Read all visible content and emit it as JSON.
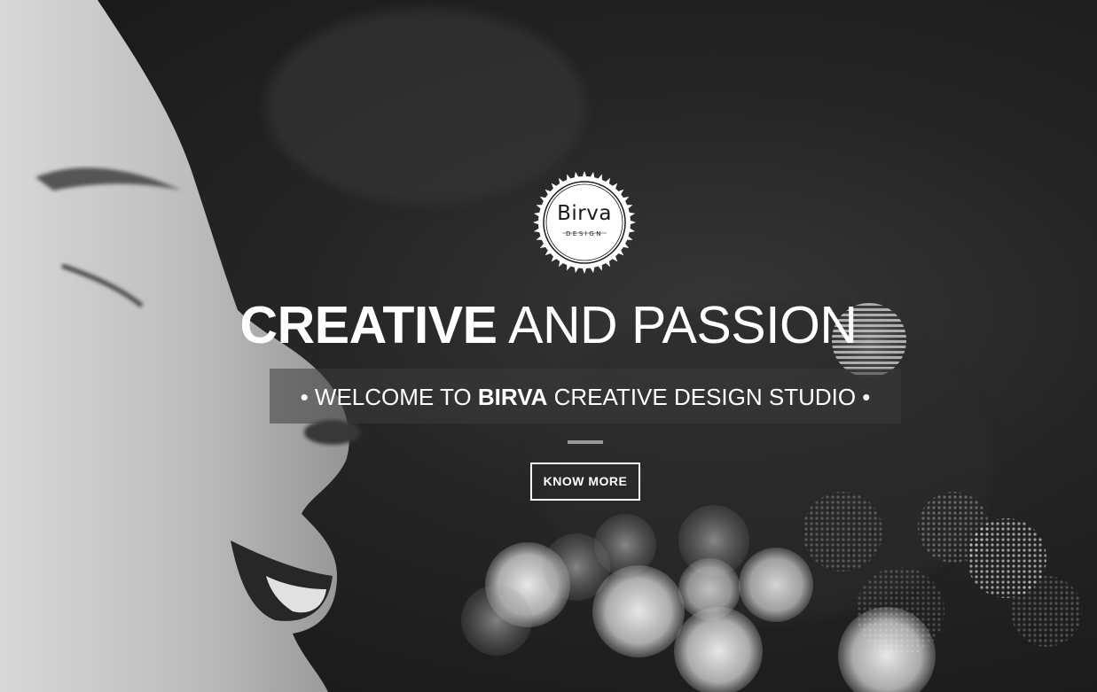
{
  "logo": {
    "name": "Birva",
    "subtitle": "DESIGN"
  },
  "hero": {
    "headline_bold": "CREATIVE",
    "headline_light": "AND PASSION",
    "tagline_prefix": "• WELCOME TO",
    "tagline_brand": "BIRVA",
    "tagline_suffix": "CREATIVE DESIGN STUDIO •",
    "cta_label": "KNOW MORE"
  },
  "colors": {
    "text": "#ffffff",
    "divider": "#9a9a9a",
    "tagline_bg": "#3c3c3c"
  }
}
